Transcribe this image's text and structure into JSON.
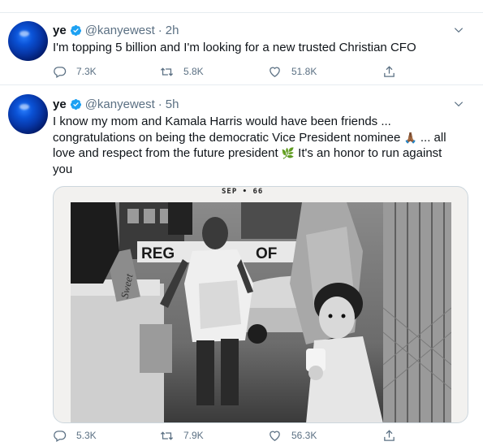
{
  "tweets": [
    {
      "name": "ye",
      "handle": "@kanyewest",
      "separator": "·",
      "time": "2h",
      "text": "I'm topping 5 billion and I'm looking for a new trusted Christian CFO",
      "replies": "7.3K",
      "retweets": "5.8K",
      "likes": "51.8K"
    },
    {
      "name": "ye",
      "handle": "@kanyewest",
      "separator": "·",
      "time": "5h",
      "text_part1": "I know my mom and Kamala Harris would have been friends ... congratulations on being the democratic Vice President nominee ",
      "emoji_hands": "🙏🏾",
      "text_part2": " ... all love and respect from the future president ",
      "emoji_plant": "🌿",
      "text_part3": " It's an honor to run against you",
      "image_caption": "SEP  •  66",
      "replies": "5.3K",
      "retweets": "7.9K",
      "likes": "56.3K"
    }
  ],
  "image_sign_text": "REG",
  "image_sign_text2": "OF",
  "image_box_text": "Sweet",
  "colors": {
    "verified": "#1da1f2",
    "muted": "#5b7083",
    "border": "#e6ecf0"
  },
  "icons": [
    "verified-badge-icon",
    "chevron-down-icon",
    "reply-icon",
    "retweet-icon",
    "like-icon",
    "share-icon"
  ]
}
